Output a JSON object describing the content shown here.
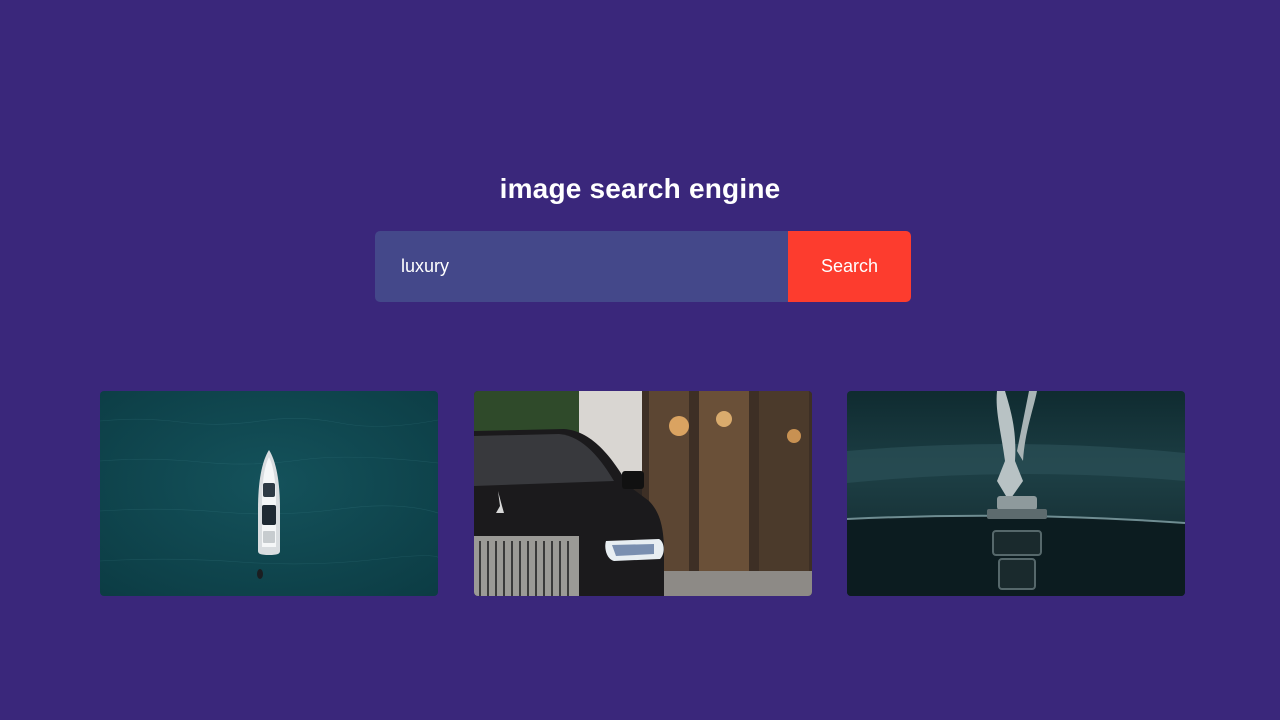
{
  "header": {
    "title": "image search engine"
  },
  "search": {
    "value": "luxury",
    "button_label": "Search"
  },
  "results": [
    {
      "subject": "yacht-aerial-view",
      "accent": "#0f4a52"
    },
    {
      "subject": "rolls-royce-car-front",
      "accent": "#1c1b1d"
    },
    {
      "subject": "spirit-of-ecstasy-hood-ornament",
      "accent": "#17343a"
    }
  ],
  "colors": {
    "background": "#3a277b",
    "input_background": "#44488a",
    "button_background": "#fd3c2e",
    "text": "#ffffff"
  }
}
